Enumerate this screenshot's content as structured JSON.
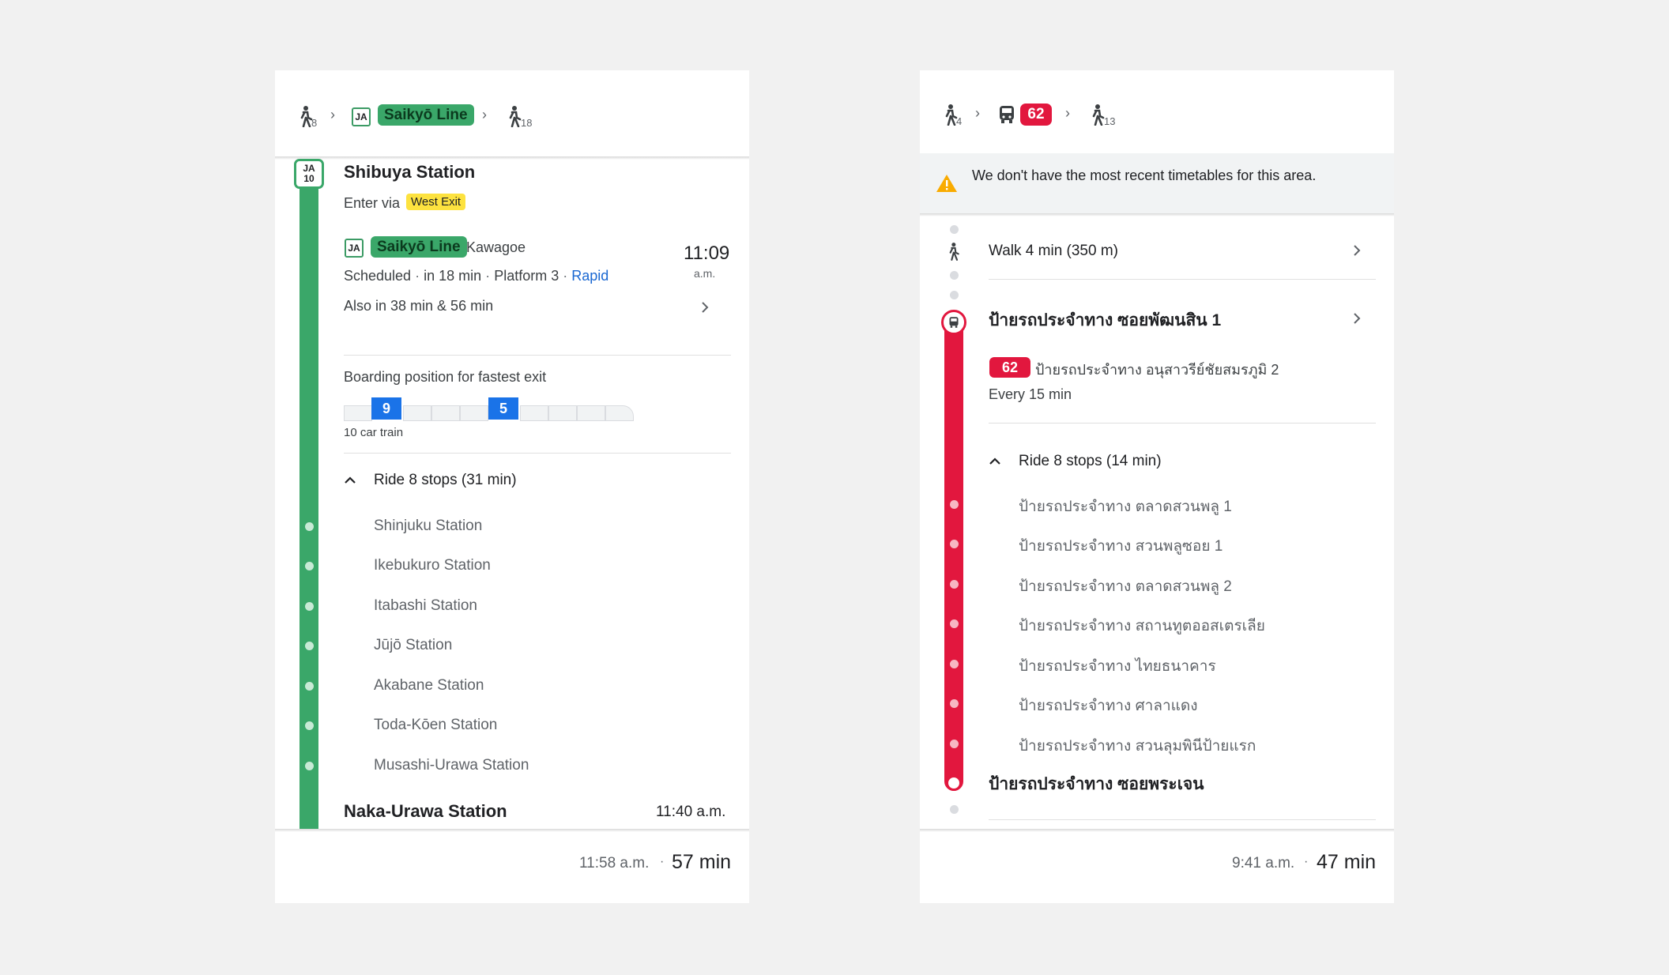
{
  "left": {
    "summary": {
      "walk_before": "8",
      "line_code": "JA",
      "line_name": "Saikyō Line",
      "walk_after": "18"
    },
    "origin": {
      "station_code_top": "JA",
      "station_code_bottom": "10",
      "name": "Shibuya Station",
      "enter_via": "Enter via",
      "exit_badge": "West Exit"
    },
    "departure": {
      "line_code": "JA",
      "line_name": "Saikyō Line",
      "destination": "Kawagoe",
      "status": "Scheduled",
      "in_time": "in 18 min",
      "platform": "Platform 3",
      "service": "Rapid",
      "sep": "·",
      "time": "11:09",
      "ampm": "a.m.",
      "also": "Also in 38 min & 56 min"
    },
    "boarding": {
      "title": "Boarding position for fastest exit",
      "car_a": "9",
      "car_b": "5",
      "train_length": "10 car train"
    },
    "ride": {
      "label": "Ride 8 stops (31 min)",
      "stops": [
        "Shinjuku Station",
        "Ikebukuro Station",
        "Itabashi Station",
        "Jūjō Station",
        "Akabane Station",
        "Toda-Kōen Station",
        "Musashi-Urawa Station"
      ]
    },
    "destination": {
      "name": "Naka-Urawa Station",
      "time": "11:40 a.m."
    },
    "footer": {
      "arrival": "11:58 a.m.",
      "sep": "·",
      "duration": "57 min"
    },
    "colors": {
      "line": "#3aa769",
      "dot": "#c8ead6"
    }
  },
  "right": {
    "summary": {
      "walk_before": "4",
      "bus_number": "62",
      "walk_after": "13"
    },
    "warning": "We don't have the most recent timetables for this area.",
    "walk_step": "Walk 4 min (350 m)",
    "origin": "ป้ายรถประจำทาง ซอยพัฒนสิน 1",
    "bus": {
      "number": "62",
      "headsign": "ป้ายรถประจำทาง อนุสาวรีย์ชัยสมรภูมิ 2",
      "frequency": "Every 15 min"
    },
    "ride": {
      "label": "Ride 8 stops (14 min)",
      "stops": [
        "ป้ายรถประจำทาง ตลาดสวนพลู 1",
        "ป้ายรถประจำทาง สวนพลูซอย 1",
        "ป้ายรถประจำทาง ตลาดสวนพลู 2",
        "ป้ายรถประจำทาง สถานทูตออสเตรเลีย",
        "ป้ายรถประจำทาง ไทยธนาคาร",
        "ป้ายรถประจำทาง ศาลาแดง",
        "ป้ายรถประจำทาง สวนลุมพินีป้ายแรก"
      ]
    },
    "destination": "ป้ายรถประจำทาง ซอยพระเจน",
    "footer": {
      "arrival": "9:41 a.m.",
      "sep": "·",
      "duration": "47 min"
    },
    "colors": {
      "line": "#e2173e",
      "dot": "#f7b7c3",
      "badge": "#e2173e",
      "warning": "#f9ab00"
    }
  }
}
